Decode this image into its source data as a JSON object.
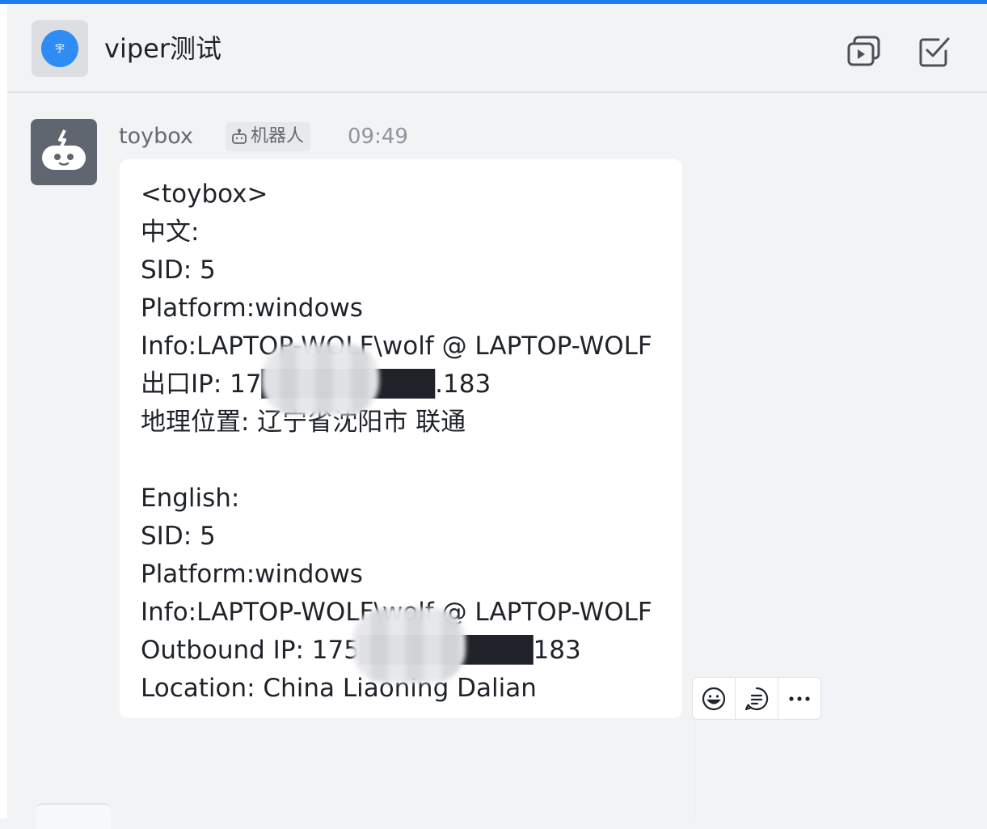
{
  "header": {
    "avatar_text": "宇",
    "title": "viper测试",
    "icons": [
      "screen-share-icon",
      "task-check-icon"
    ]
  },
  "message": {
    "sender": "toybox",
    "bot_tag": "机器人",
    "time": "09:49",
    "lines": [
      "<toybox>",
      "中文:",
      "SID: 5",
      "Platform:windows",
      "Info:LAPTOP-WOLF\\wolf @ LAPTOP-WOLF",
      "出口IP: 17█████████.183",
      "地理位置: 辽宁省沈阳市 联通",
      "",
      "English:",
      "SID: 5",
      "Platform:windows",
      "Info:LAPTOP-WOLF\\wolf @ LAPTOP-WOLF",
      "Outbound IP: 175█████████183",
      "Location: China Liaoning Dalian"
    ]
  },
  "actions": [
    "emoji-reaction-icon",
    "reply-comment-icon",
    "more-icon"
  ],
  "colors": {
    "accent": "#1f7cf0",
    "avatar_blue": "#2f8cf4",
    "bot_avatar": "#5f6670",
    "background": "#f2f3f5",
    "bubble": "#ffffff",
    "text": "#1f2329",
    "muted_text": "#8f959e"
  }
}
